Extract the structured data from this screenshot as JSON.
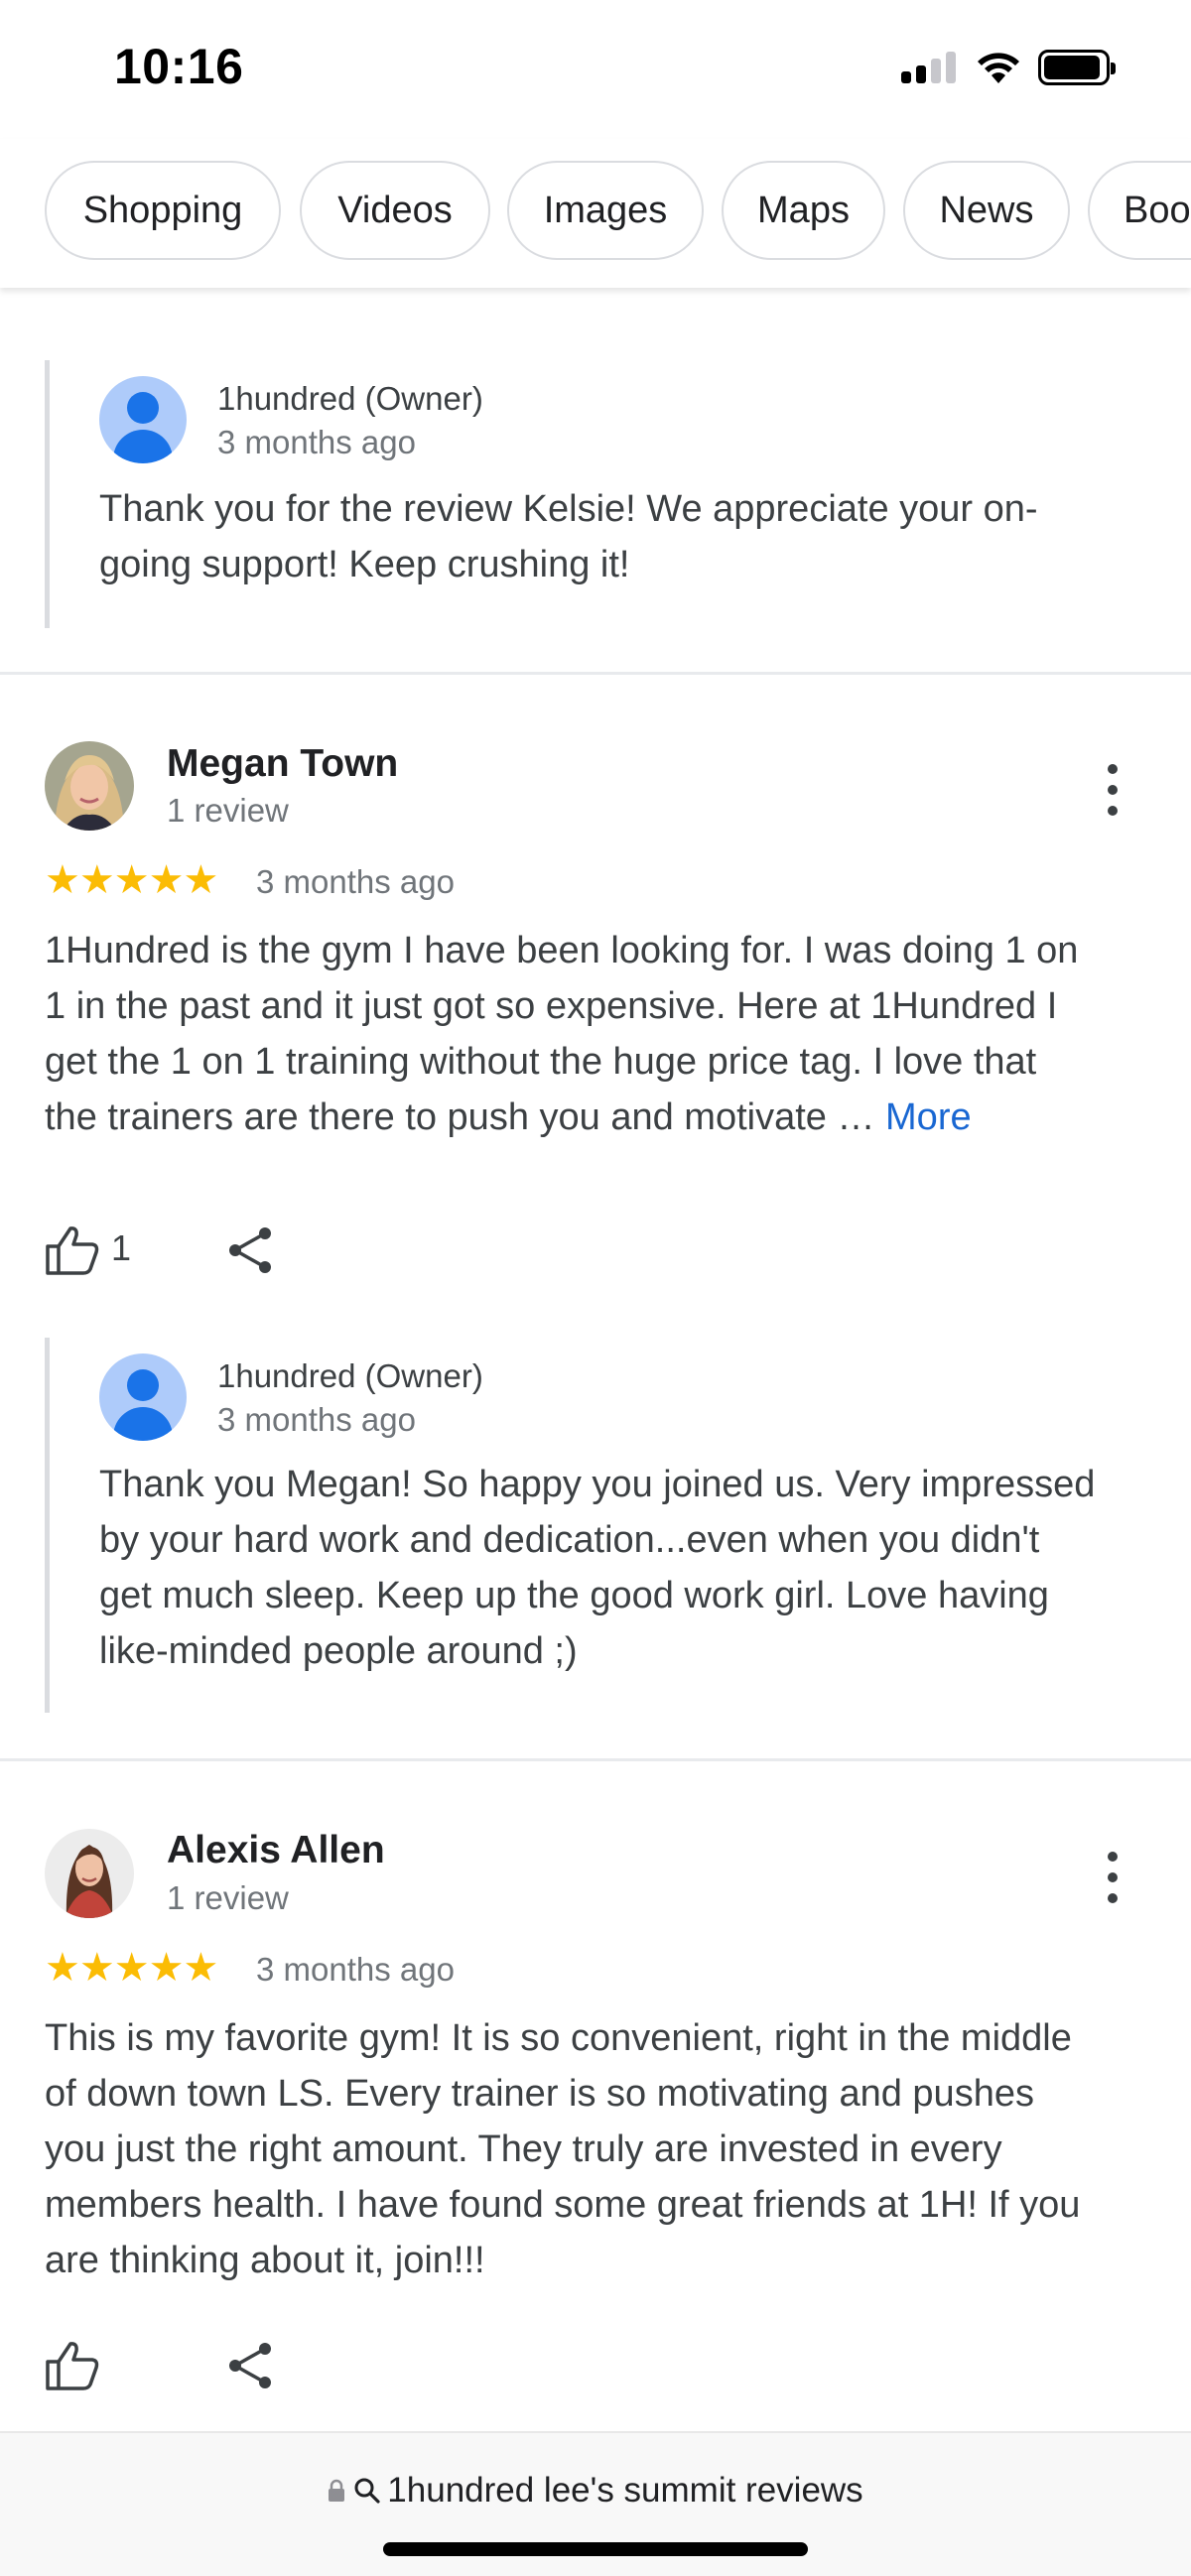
{
  "status_bar": {
    "time": "10:16"
  },
  "chips": [
    "Shopping",
    "Videos",
    "Images",
    "Maps",
    "News",
    "Boo"
  ],
  "reviews": [
    {
      "owner_reply": {
        "name": "1hundred (Owner)",
        "time": "3 months ago",
        "text_lines": [
          "Thank you for the review Kelsie! We appreciate your on-",
          "going support! Keep crushing it!"
        ]
      }
    },
    {
      "name": "Megan Town",
      "review_count": "1 review",
      "stars": "★★★★★",
      "rating": 5,
      "time": "3 months ago",
      "text_lines": [
        "1Hundred is the gym I have been looking for. I was doing 1 on",
        "1 in the past and it just got so expensive. Here at 1Hundred I",
        "get the 1 on 1 training without the huge price tag. I love that",
        "the trainers are there to push you and motivate … "
      ],
      "more_label": "More",
      "likes": "1",
      "owner_reply": {
        "name": "1hundred (Owner)",
        "time": "3 months ago",
        "text_lines": [
          "Thank you Megan! So happy you joined us. Very impressed",
          "by your hard work and dedication...even when you didn't",
          "get much sleep. Keep up the good work girl. Love having",
          "like-minded people around ;)"
        ]
      }
    },
    {
      "name": "Alexis Allen",
      "review_count": "1 review",
      "stars": "★★★★★",
      "rating": 5,
      "time": "3 months ago",
      "text_lines": [
        "This is my favorite gym! It is so convenient, right in the middle",
        "of down town LS. Every trainer is so motivating and pushes",
        "you just the right amount. They truly are invested in every",
        "members health. I have found some great friends at 1H! If you",
        "are thinking about it, join!!!"
      ]
    }
  ],
  "bottom_bar": {
    "url": "1hundred lee's summit reviews"
  },
  "colors": {
    "star": "#fbbc04",
    "link": "#1967d2",
    "owner_avatar": "#1a73e8"
  }
}
